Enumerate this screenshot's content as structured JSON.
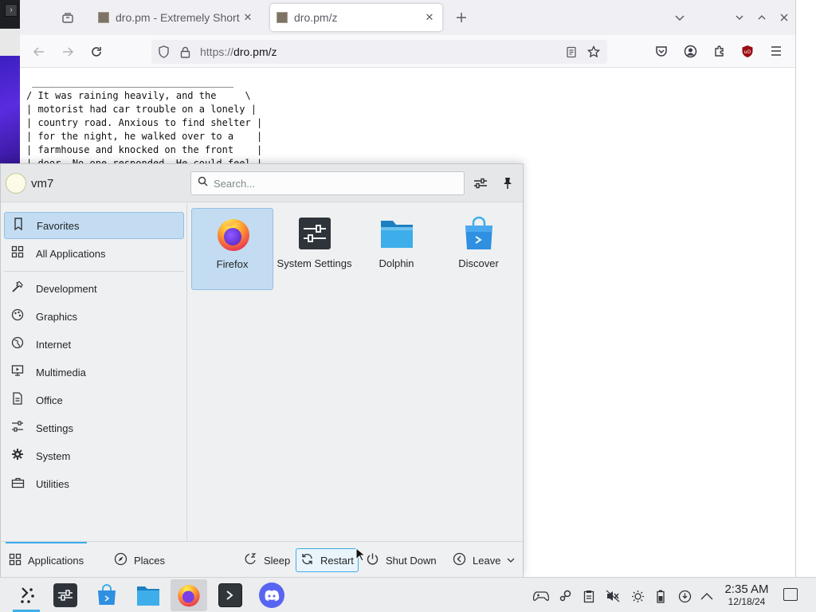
{
  "desktop": {
    "terminal_button_glyph": "›"
  },
  "browser": {
    "tabs": [
      {
        "title": "dro.pm - Extremely Short URLs",
        "active": false
      },
      {
        "title": "dro.pm/z",
        "active": true
      }
    ],
    "url": {
      "scheme": "https://",
      "host": "dro.pm/z"
    },
    "page_text": " ___________________________________\n/ It was raining heavily, and the     \\\n| motorist had car trouble on a lonely |\n| country road. Anxious to find shelter |\n| for the night, he walked over to a    |\n| farmhouse and knocked on the front    |\n| door. No one responded. He could feel |"
  },
  "launcher": {
    "username": "vm7",
    "search": {
      "placeholder": "Search..."
    },
    "categories": [
      {
        "label": "Favorites",
        "icon": "bookmark-icon"
      },
      {
        "label": "All Applications",
        "icon": "grid-icon"
      },
      {
        "label": "Development",
        "icon": "hammer-icon"
      },
      {
        "label": "Graphics",
        "icon": "palette-icon"
      },
      {
        "label": "Internet",
        "icon": "globe-icon"
      },
      {
        "label": "Multimedia",
        "icon": "media-icon"
      },
      {
        "label": "Office",
        "icon": "document-icon"
      },
      {
        "label": "Settings",
        "icon": "sliders-icon"
      },
      {
        "label": "System",
        "icon": "gear-icon"
      },
      {
        "label": "Utilities",
        "icon": "toolbox-icon"
      }
    ],
    "favorites": [
      {
        "label": "Firefox",
        "icon": "firefox-icon"
      },
      {
        "label": "System Settings",
        "icon": "system-settings-icon"
      },
      {
        "label": "Dolphin",
        "icon": "folder-icon"
      },
      {
        "label": "Discover",
        "icon": "discover-bag-icon"
      }
    ],
    "footer": {
      "applications": "Applications",
      "places": "Places",
      "sleep": "Sleep",
      "restart": "Restart",
      "shut_down": "Shut Down",
      "leave": "Leave"
    }
  },
  "taskbar": {
    "clock_time": "2:35 AM",
    "clock_date": "12/18/24"
  },
  "colors": {
    "accent": "#3daee9",
    "selection": "#c3dcf1",
    "panel": "#eff0f1"
  }
}
